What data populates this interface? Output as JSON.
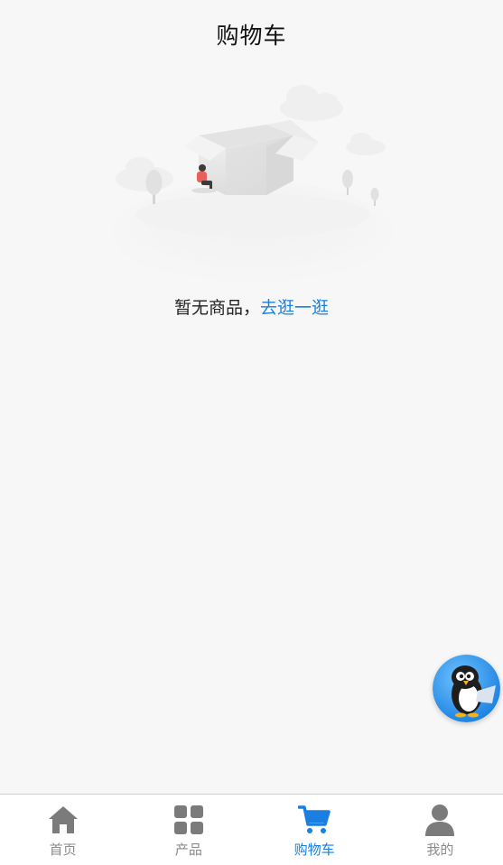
{
  "header": {
    "title": "购物车"
  },
  "empty_state": {
    "message": "暂无商品，",
    "action_label": "去逛一逛"
  },
  "tabs": [
    {
      "label": "首页",
      "icon": "home-icon",
      "active": false
    },
    {
      "label": "产品",
      "icon": "grid-icon",
      "active": false
    },
    {
      "label": "购物车",
      "icon": "cart-icon",
      "active": true
    },
    {
      "label": "我的",
      "icon": "user-icon",
      "active": false
    }
  ],
  "colors": {
    "accent": "#1a7fe0",
    "background": "#f7f7f7",
    "tab_inactive": "#8a8a8a"
  }
}
